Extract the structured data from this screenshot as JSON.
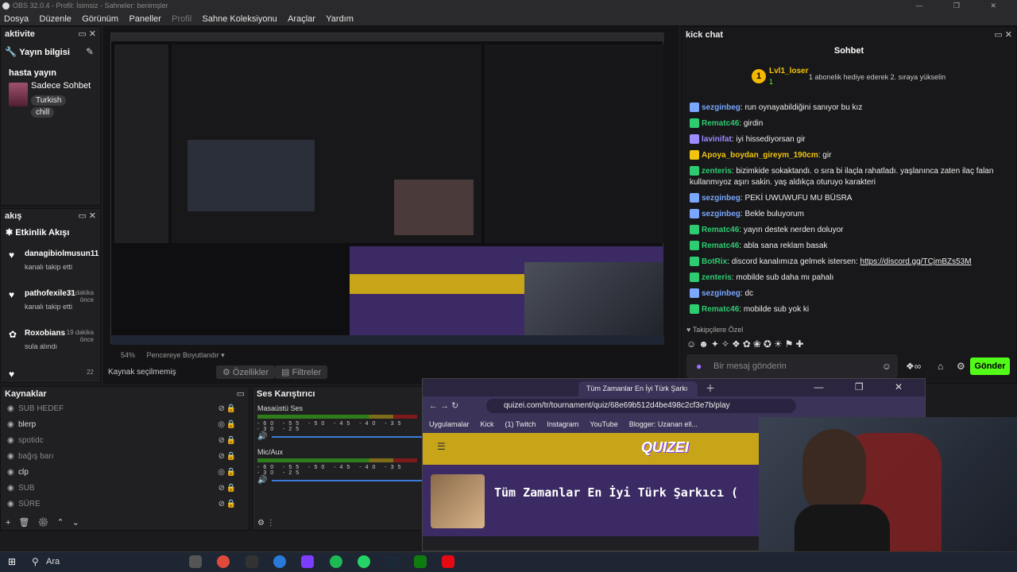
{
  "app": {
    "title": "OBS 32.0.4 - Profil: İsimsiz - Sahneler: benimşler"
  },
  "menu": [
    "Dosya",
    "Düzenle",
    "Görünüm",
    "Paneller",
    "Profil",
    "Sahne Koleksiyonu",
    "Araçlar",
    "Yardım"
  ],
  "activity": {
    "title": "aktivite",
    "section": "Yayın bilgisi",
    "stream_title": "hasta yayın",
    "category": "Sadece Sohbet",
    "tags": [
      "Turkish",
      "chill"
    ]
  },
  "feed": {
    "title": "akış",
    "section": "Etkinlik Akışı",
    "items": [
      {
        "name": "danagibiolmusun11",
        "sub": "kanalı takip etti",
        "age": ""
      },
      {
        "name": "pathofexile31",
        "sub": "kanalı takip etti",
        "age": "17 dakika önce"
      },
      {
        "name": "Roxobians",
        "sub": "sula alındı",
        "age": "19 dakika önce"
      },
      {
        "name": "",
        "sub": "",
        "age": "22"
      }
    ]
  },
  "preview": {
    "zoom": "54%",
    "fit": "Pencereye Boyutlandır",
    "no_source": "Kaynak seçilmemiş",
    "properties": "Özellikler",
    "filters": "Filtreler"
  },
  "chat": {
    "title": "kick chat",
    "header": "Sohbet",
    "pinned_user": "Lvl1_loser",
    "pinned_count": "1",
    "pinned_msg": "1 abonelik hediye ederek 2. sıraya yükselin",
    "messages": [
      {
        "user": "sezginbeg",
        "text": "run oynayabildiğini sanıyor bu kız",
        "color": "#7aa7ff"
      },
      {
        "user": "Rematc46",
        "text": "girdin",
        "color": "#2ecc71"
      },
      {
        "user": "lavinifat",
        "text": "iyi hissediyorsan gir",
        "color": "#9b8cff"
      },
      {
        "user": "Apoya_boydan_gireym_190cm",
        "text": "gir",
        "color": "#f1c40f"
      },
      {
        "user": "zenteris",
        "text": "bizimkide sokaktandı. o sıra bi ilaçla rahatladı. yaşlanınca zaten ilaç falan kullanmıyoz aşırı sakin. yaş aldıkça oturuyo karakteri",
        "color": "#2ecc71"
      },
      {
        "user": "sezginbeg",
        "text": "PEKİ UWUWUFU MU BÜSRA",
        "color": "#7aa7ff"
      },
      {
        "user": "sezginbeg",
        "text": "Bekle buluyorum",
        "color": "#7aa7ff"
      },
      {
        "user": "Rematc46",
        "text": "yayın destek nerden doluyor",
        "color": "#2ecc71"
      },
      {
        "user": "Rematc46",
        "text": "abla sana reklam basak",
        "color": "#2ecc71"
      },
      {
        "user": "BotRix",
        "text": "discord kanalımıza gelmek istersen: ",
        "link": "https://discord.gg/TCjmBZs53M",
        "color": "#2ecc71"
      },
      {
        "user": "zenteris",
        "text": "mobilde sub daha mı pahalı",
        "color": "#2ecc71"
      },
      {
        "user": "sezginbeg",
        "text": "dc",
        "color": "#7aa7ff"
      },
      {
        "user": "Rematc46",
        "text": "mobilde sub yok ki",
        "color": "#2ecc71"
      }
    ],
    "followers_only": "Takipçilere Özel",
    "input_placeholder": "Bir mesaj gönderin",
    "send": "Gönder"
  },
  "sources": {
    "title": "Kaynaklar",
    "items": [
      {
        "name": "SUB HEDEF",
        "visible": false
      },
      {
        "name": "blerp",
        "visible": true
      },
      {
        "name": "spotidc",
        "visible": false
      },
      {
        "name": "bağış barı",
        "visible": false
      },
      {
        "name": "clp",
        "visible": true
      },
      {
        "name": "SUB",
        "visible": false
      },
      {
        "name": "SÜRE",
        "visible": false
      }
    ]
  },
  "mixer": {
    "title": "Ses Karıştırıcı",
    "channels": [
      {
        "name": "Masaüstü Ses"
      },
      {
        "name": "Mic/Aux"
      }
    ],
    "ticks": "-60 -55 -50 -45 -40 -35 -30 -25"
  },
  "browser": {
    "tab_title": "Tüm Zamanlar En İyi Türk Şarkı",
    "url": "quizei.com/tr/tournament/quiz/68e69b512d4be498c2cf3e7b/play",
    "bookmarks": [
      "Uygulamalar",
      "Kick",
      "(1) Twitch",
      "Instagram",
      "YouTube",
      "Blogger: Uzanan ell..."
    ],
    "site_logo": "QUIZEI",
    "quiz_title": "Tüm Zamanlar En İyi Türk Şarkıcı ("
  },
  "taskbar": {
    "search": "Ara"
  },
  "colors": {
    "kick_green": "#53fc18",
    "accent_purple": "#7d3cff"
  }
}
